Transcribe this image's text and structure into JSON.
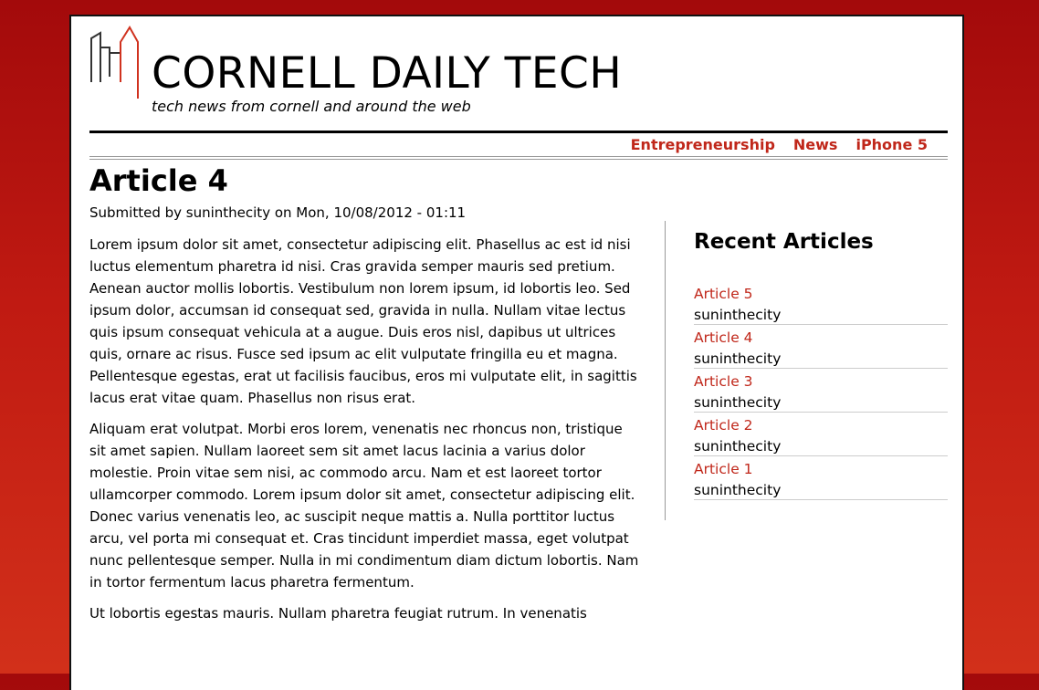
{
  "site": {
    "title": "CORNELL DAILY TECH",
    "slogan": "tech news from cornell and around the web",
    "logo_icon": "city-skyline-icon"
  },
  "nav": {
    "items": [
      {
        "label": "Entrepreneurship"
      },
      {
        "label": "News"
      },
      {
        "label": "iPhone 5"
      }
    ]
  },
  "article": {
    "title": "Article 4",
    "submitted": "Submitted by suninthecity on Mon, 10/08/2012 - 01:11",
    "paragraphs": [
      "Lorem ipsum dolor sit amet, consectetur adipiscing elit. Phasellus ac est id nisi luctus elementum pharetra id nisi. Cras gravida semper mauris sed pretium. Aenean auctor mollis lobortis. Vestibulum non lorem ipsum, id lobortis leo. Sed ipsum dolor, accumsan id consequat sed, gravida in nulla. Nullam vitae lectus quis ipsum consequat vehicula at a augue. Duis eros nisl, dapibus ut ultrices quis, ornare ac risus. Fusce sed ipsum ac elit vulputate fringilla eu et magna. Pellentesque egestas, erat ut facilisis faucibus, eros mi vulputate elit, in sagittis lacus erat vitae quam. Phasellus non risus erat.",
      "Aliquam erat volutpat. Morbi eros lorem, venenatis nec rhoncus non, tristique sit amet sapien. Nullam laoreet sem sit amet lacus lacinia a varius dolor molestie. Proin vitae sem nisi, ac commodo arcu. Nam et est laoreet tortor ullamcorper commodo. Lorem ipsum dolor sit amet, consectetur adipiscing elit. Donec varius venenatis leo, ac suscipit neque mattis a. Nulla porttitor luctus arcu, vel porta mi consequat et. Cras tincidunt imperdiet massa, eget volutpat nunc pellentesque semper. Nulla in mi condimentum diam dictum lobortis. Nam in tortor fermentum lacus pharetra fermentum.",
      "Ut lobortis egestas mauris. Nullam pharetra feugiat rutrum. In venenatis"
    ]
  },
  "sidebar": {
    "heading": "Recent Articles",
    "items": [
      {
        "title": "Article 5",
        "author": "suninthecity"
      },
      {
        "title": "Article 4",
        "author": "suninthecity"
      },
      {
        "title": "Article 3",
        "author": "suninthecity"
      },
      {
        "title": "Article 2",
        "author": "suninthecity"
      },
      {
        "title": "Article 1",
        "author": "suninthecity"
      }
    ]
  },
  "colors": {
    "accent": "#c0271a",
    "background_top": "#a30a0b",
    "background_bottom": "#d2301a"
  }
}
